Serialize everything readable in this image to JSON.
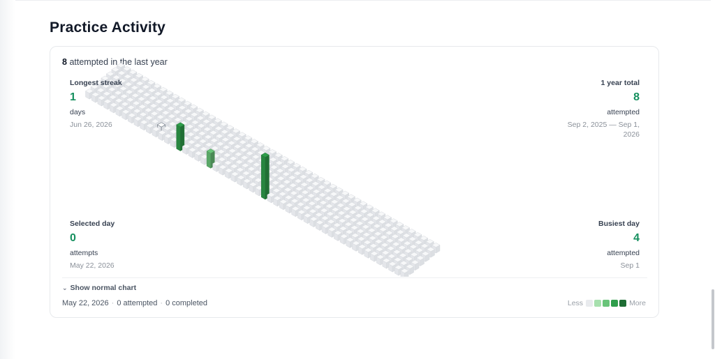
{
  "page": {
    "title": "Practice Activity"
  },
  "summary": {
    "count": "8",
    "text": "attempted in the last year"
  },
  "stats": {
    "longest_streak": {
      "label": "Longest streak",
      "value": "1",
      "unit": "days",
      "date": "Jun 26, 2026"
    },
    "year_total": {
      "label": "1 year total",
      "value": "8",
      "unit": "attempted",
      "date": "Sep 2, 2025 — Sep 1, 2026"
    },
    "selected_day": {
      "label": "Selected day",
      "value": "0",
      "unit": "attempts",
      "date": "May 22, 2026"
    },
    "busiest_day": {
      "label": "Busiest day",
      "value": "4",
      "unit": "attempted",
      "date": "Sep 1"
    }
  },
  "toggle": {
    "label": "Show normal chart",
    "icon": "chevron-down-icon"
  },
  "footer": {
    "date": "May 22, 2026",
    "attempted": "0 attempted",
    "completed": "0 completed",
    "sep": "·"
  },
  "legend": {
    "less": "Less",
    "more": "More",
    "colors": [
      "#e9ebee",
      "#a7e0ae",
      "#69c479",
      "#2f9e4b",
      "#1e6d34"
    ]
  },
  "colors": {
    "accent": "#16905f",
    "selected_outline": "#4b5563"
  },
  "chart_data": {
    "type": "heatmap",
    "weeks": 53,
    "days_per_week": 7,
    "max_value": 4,
    "selected": {
      "week": 11,
      "day": 5
    },
    "bars": [
      {
        "week": 15,
        "day": 6,
        "value": 2
      },
      {
        "week": 20,
        "day": 6,
        "value": 1
      },
      {
        "week": 29,
        "day": 6,
        "value": 4
      }
    ]
  }
}
